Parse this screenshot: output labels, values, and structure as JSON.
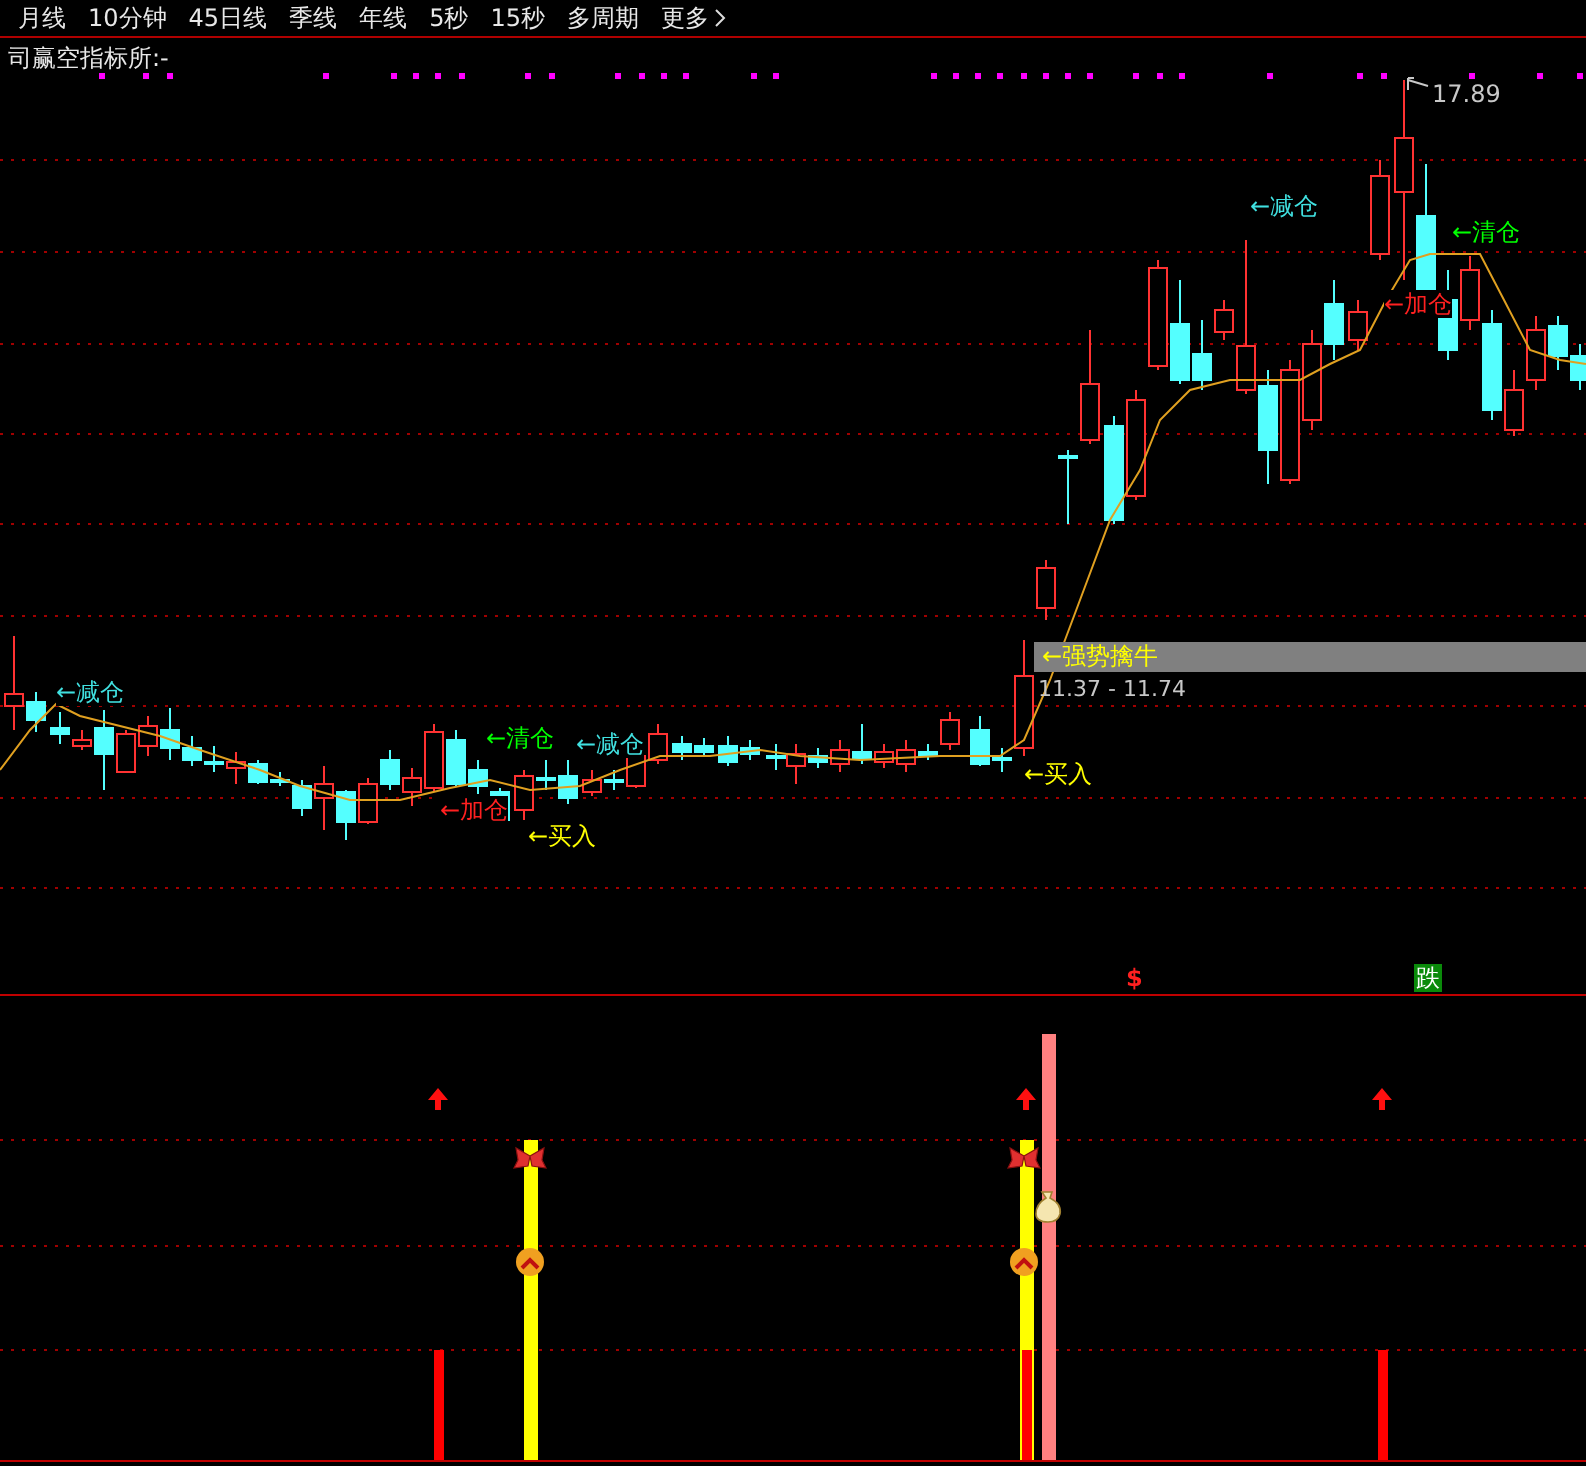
{
  "menu": [
    {
      "label": "月线",
      "chevron": false
    },
    {
      "label": "10分钟",
      "chevron": false
    },
    {
      "label": "45日线",
      "chevron": false
    },
    {
      "label": "季线",
      "chevron": false
    },
    {
      "label": "年线",
      "chevron": false
    },
    {
      "label": "5秒",
      "chevron": false
    },
    {
      "label": "15秒",
      "chevron": false
    },
    {
      "label": "多周期",
      "chevron": false
    },
    {
      "label": "更多",
      "chevron": true
    }
  ],
  "indicator_title": "司赢空指标所:-",
  "price_label": "17.89",
  "signals": [
    {
      "text": "←减仓",
      "color": "#40e0e0"
    },
    {
      "text": "←加仓",
      "color": "#ff2020"
    },
    {
      "text": "←清仓",
      "color": "#00ff00"
    },
    {
      "text": "←买入",
      "color": "#ffff00"
    },
    {
      "text": "←减仓",
      "color": "#40e0e0"
    },
    {
      "text": "←买入",
      "color": "#ffff00"
    },
    {
      "text": "←减仓",
      "color": "#40e0e0"
    },
    {
      "text": "←加仓",
      "color": "#ff2020"
    },
    {
      "text": "←清仓",
      "color": "#00ff00"
    }
  ],
  "banner": {
    "text": "←强势擒牛",
    "range": "11.37 - 11.74"
  },
  "markers": [
    {
      "kind": "dollar",
      "text": "$"
    },
    {
      "kind": "fall",
      "text": "跌"
    }
  ]
}
